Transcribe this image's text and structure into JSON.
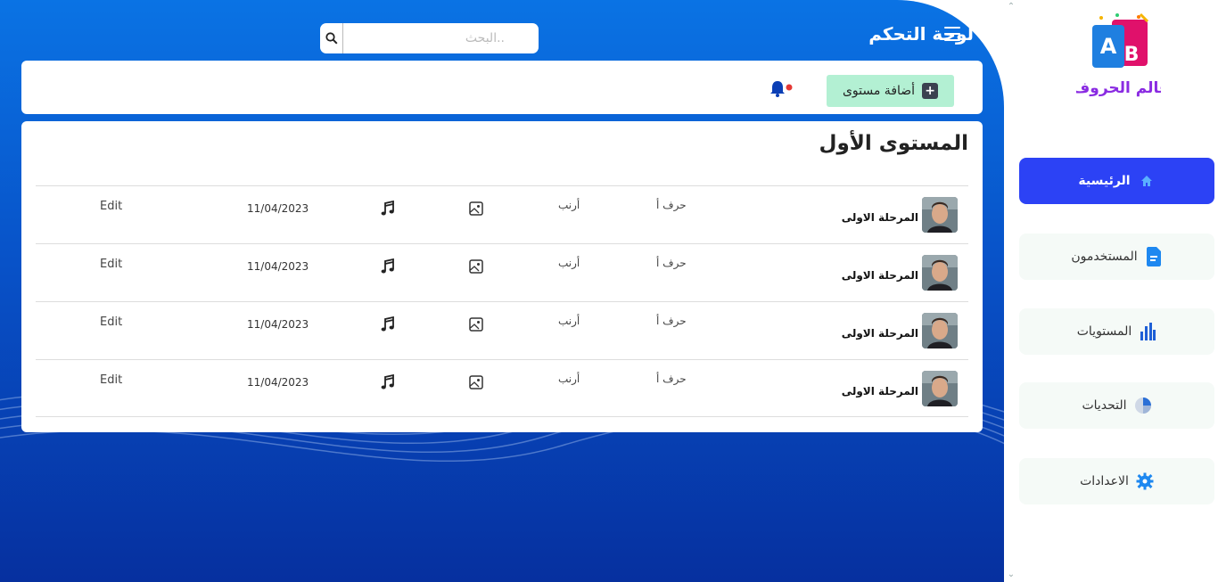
{
  "header": {
    "title": "لوحة التحكم",
    "search_placeholder": "البحث.."
  },
  "toolbar": {
    "add_level_label": "أضافة مستوى",
    "notification_badge_color": "#e53935"
  },
  "card": {
    "title": "المستوى الأول",
    "rows": [
      {
        "stage": "المرحلة الاولى",
        "letter": "حرف أ",
        "word": "أرنب",
        "date": "11/04/2023",
        "action": "Edit"
      },
      {
        "stage": "المرحلة الاولى",
        "letter": "حرف أ",
        "word": "أرنب",
        "date": "11/04/2023",
        "action": "Edit"
      },
      {
        "stage": "المرحلة الاولى",
        "letter": "حرف أ",
        "word": "أرنب",
        "date": "11/04/2023",
        "action": "Edit"
      },
      {
        "stage": "المرحلة الاولى",
        "letter": "حرف أ",
        "word": "أرنب",
        "date": "11/04/2023",
        "action": "Edit"
      }
    ]
  },
  "sidebar": {
    "logo_text": "عالم الحروف",
    "logo_letters": [
      "A",
      "B"
    ],
    "items": [
      {
        "label": "الرئيسية",
        "icon": "home-icon",
        "active": true
      },
      {
        "label": "المستخدمون",
        "icon": "document-icon",
        "active": false
      },
      {
        "label": "المستويات",
        "icon": "bar-chart-icon",
        "active": false
      },
      {
        "label": "التحديات",
        "icon": "pie-chart-icon",
        "active": false
      },
      {
        "label": "الاعدادات",
        "icon": "gear-icon",
        "active": false
      }
    ]
  },
  "colors": {
    "main_bg_top": "#0a73e4",
    "main_bg_bottom": "#06309f",
    "active_nav": "#2c42f5",
    "add_button": "#b3f0d3"
  }
}
